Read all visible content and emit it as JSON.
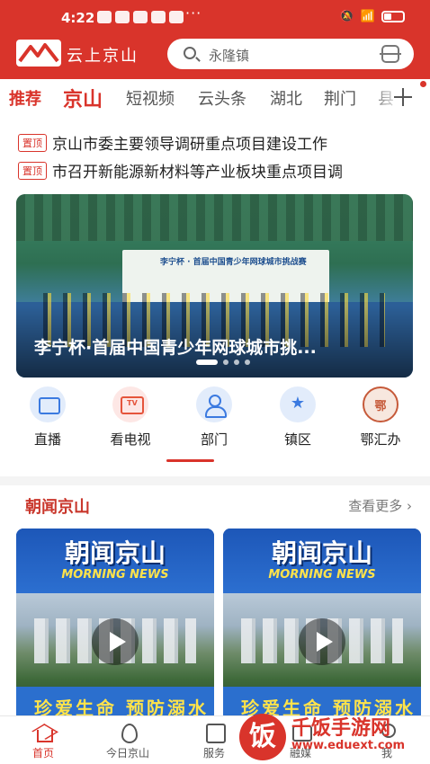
{
  "status_bar": {
    "time": "4:22",
    "more": "···"
  },
  "header": {
    "logo_text": "云上京山",
    "search": {
      "placeholder": "永隆镇"
    }
  },
  "tabs": [
    {
      "label": "推荐"
    },
    {
      "label": "京山"
    },
    {
      "label": "短视频"
    },
    {
      "label": "云头条"
    },
    {
      "label": "湖北"
    },
    {
      "label": "荆门"
    },
    {
      "label": "县"
    }
  ],
  "pinned": [
    {
      "badge": "置顶",
      "title": "京山市委主要领导调研重点项目建设工作"
    },
    {
      "badge": "置顶",
      "title": "市召开新能源新材料等产业板块重点项目调"
    }
  ],
  "banner": {
    "caption": "李宁杯·首届中国青少年网球城市挑...",
    "backdrop_text": "李宁杯 · 首届中国青少年网球城市挑战赛"
  },
  "shortcuts": [
    {
      "label": "直播",
      "icon": "live-icon"
    },
    {
      "label": "看电视",
      "icon": "tv-icon"
    },
    {
      "label": "部门",
      "icon": "department-icon"
    },
    {
      "label": "镇区",
      "icon": "town-icon"
    },
    {
      "label": "鄂汇办",
      "icon": "ehuiban-icon"
    }
  ],
  "news": {
    "title": "朝闻京山",
    "more": "查看更多",
    "cards": [
      {
        "title": "朝闻京山",
        "subtitle": "MORNING NEWS",
        "bottom_text": "珍爱生命 预防溺水"
      },
      {
        "title": "朝闻京山",
        "subtitle": "MORNING NEWS",
        "bottom_text": "珍爱生命 预防溺水"
      }
    ]
  },
  "bottom_nav": [
    {
      "label": "首页",
      "icon": "home-icon"
    },
    {
      "label": "今日京山",
      "icon": "fire-icon"
    },
    {
      "label": "服务",
      "icon": "edit-icon"
    },
    {
      "label": "融媒",
      "icon": "media-icon"
    },
    {
      "label": "我",
      "icon": "me-icon"
    }
  ],
  "watermark": {
    "logo": "饭",
    "name": "千饭手游网",
    "url": "www.eduext.com"
  },
  "colors": {
    "brand_red": "#d9342b",
    "accent_blue": "#3b7ae0"
  }
}
